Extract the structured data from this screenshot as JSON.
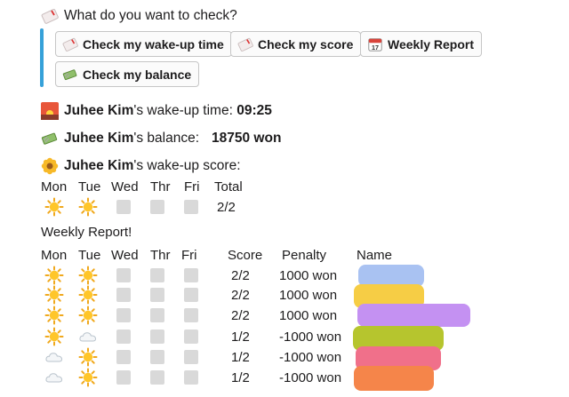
{
  "prompt": {
    "icon": "ticket-icon",
    "text": "What do you want to check?"
  },
  "buttons": [
    {
      "icon": "ticket-icon",
      "label": "Check my wake-up time"
    },
    {
      "icon": "ticket-icon",
      "label": "Check my score"
    },
    {
      "icon": "calendar-icon",
      "label": "Weekly Report",
      "icon_text": "17"
    },
    {
      "icon": "money-icon",
      "label": "Check my balance"
    }
  ],
  "wakeup": {
    "name": "Juhee Kim",
    "suffix": "'s wake-up time: ",
    "value": "09:25"
  },
  "balance": {
    "name": "Juhee Kim",
    "suffix": "'s balance:",
    "value": "18750 won"
  },
  "score": {
    "name": "Juhee Kim",
    "suffix": "'s wake-up score:",
    "headers": [
      "Mon",
      "Tue",
      "Wed",
      "Thr",
      "Fri",
      "Total"
    ],
    "days": [
      "sun",
      "sun",
      "empty",
      "empty",
      "empty"
    ],
    "total": "2/2"
  },
  "weekly": {
    "title": "Weekly Report!",
    "headers": [
      "Mon",
      "Tue",
      "Wed",
      "Thr",
      "Fri",
      "Score",
      "Penalty",
      "Name"
    ],
    "rows": [
      {
        "days": [
          "sun",
          "sun",
          "empty",
          "empty",
          "empty"
        ],
        "score": "2/2",
        "penalty": "1000 won",
        "name_color": "#a9c2f2"
      },
      {
        "days": [
          "sun",
          "sun",
          "empty",
          "empty",
          "empty"
        ],
        "score": "2/2",
        "penalty": "1000 won",
        "name_color": "#f6cd45"
      },
      {
        "days": [
          "sun",
          "sun",
          "empty",
          "empty",
          "empty"
        ],
        "score": "2/2",
        "penalty": "1000 won",
        "name_color": "#c491f2"
      },
      {
        "days": [
          "sun",
          "cloud",
          "empty",
          "empty",
          "empty"
        ],
        "score": "1/2",
        "penalty": "-1000 won",
        "name_color": "#b6c52e"
      },
      {
        "days": [
          "cloud",
          "sun",
          "empty",
          "empty",
          "empty"
        ],
        "score": "1/2",
        "penalty": "-1000 won",
        "name_color": "#f0708a"
      },
      {
        "days": [
          "cloud",
          "sun",
          "empty",
          "empty",
          "empty"
        ],
        "score": "1/2",
        "penalty": "-1000 won",
        "name_color": "#f5854a"
      }
    ]
  },
  "colors": {
    "accent_bar": "#36a1d9",
    "empty_box": "#d9d9d9"
  }
}
